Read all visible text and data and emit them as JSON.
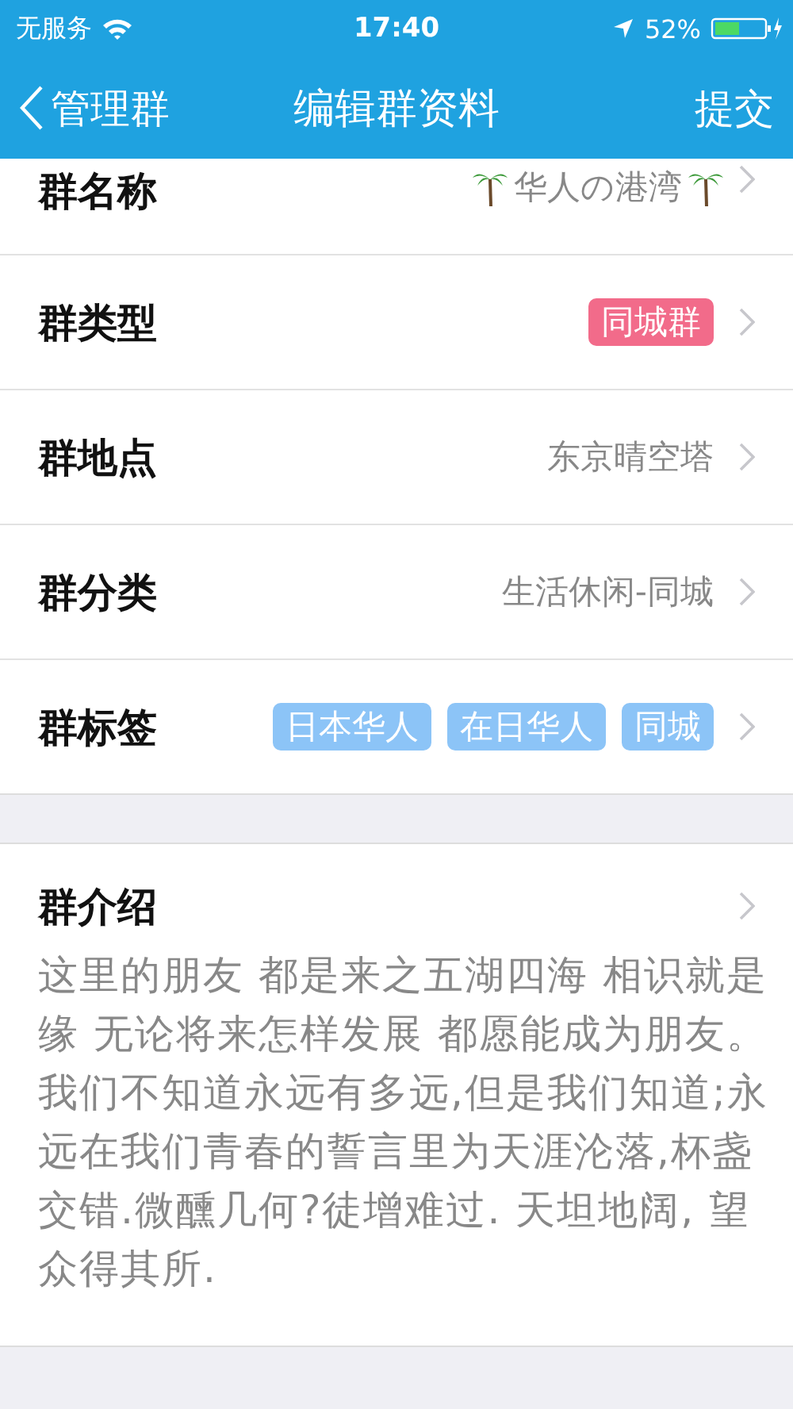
{
  "status_bar": {
    "carrier": "无服务",
    "time": "17:40",
    "battery": "52%"
  },
  "nav": {
    "back": "管理群",
    "title": "编辑群资料",
    "action": "提交"
  },
  "rows": [
    {
      "kind": "text",
      "label": "群名称",
      "value": "华人の港湾",
      "palms": true
    },
    {
      "kind": "tag",
      "label": "群类型",
      "tags": [
        {
          "text": "同城群",
          "color": "#f26b8a"
        }
      ]
    },
    {
      "kind": "text",
      "label": "群地点",
      "value": "东京晴空塔",
      "palms": false
    },
    {
      "kind": "text",
      "label": "群分类",
      "value": "生活休闲-同城",
      "palms": false
    },
    {
      "kind": "tag",
      "label": "群标签",
      "tags": [
        {
          "text": "日本华人",
          "color": "#8cc4f7"
        },
        {
          "text": "在日华人",
          "color": "#8cc4f7"
        },
        {
          "text": "同城",
          "color": "#8cc4f7"
        }
      ]
    }
  ],
  "intro": {
    "label": "群介绍",
    "text": "这里的朋友 都是来之五湖四海 相识就是缘 无论将来怎样发展 都愿能成为朋友。我们不知道永远有多远,但是我们知道;永远在我们青春的誓言里为天涯沦落,杯盏交错.微醺几何?徒增难过. 天坦地阔, 望众得其所."
  }
}
